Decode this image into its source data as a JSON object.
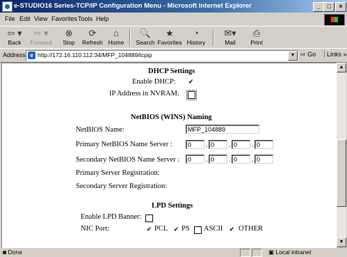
{
  "window": {
    "title": "e-STUDIO16 Series-TCP/IP Configuration Menu - Microsoft Internet Explorer",
    "buttons": {
      "minimize": "_",
      "maximize": "□",
      "close": "×"
    }
  },
  "menubar": {
    "items": [
      "File",
      "Edit",
      "View",
      "Favorites",
      "Tools",
      "Help"
    ]
  },
  "toolbar": {
    "back": "Back",
    "forward": "Forward",
    "stop": "Stop",
    "refresh": "Refresh",
    "home": "Home",
    "search": "Search",
    "favorites": "Favorites",
    "history": "History",
    "mail": "Mail",
    "print": "Print"
  },
  "address": {
    "label": "Address",
    "url": "http://172.16.110.112:34/MFP_104889/tcpip",
    "go": "Go",
    "links": "Links »"
  },
  "content": {
    "dhcp": {
      "heading": "DHCP Settings",
      "enable_label": "Enable DHCP:",
      "enable_checked": true,
      "nvram_label": "IP Address in NVRAM:",
      "nvram_checked": false
    },
    "netbios": {
      "heading": "NetBIOS (WINS) Naming",
      "name_label": "NetBIOS Name:",
      "name_value": "MFP_104889",
      "primary_label": "Primary NetBIOS Name Server :",
      "primary_octets": [
        "0",
        "0",
        "0",
        "0"
      ],
      "secondary_label": "Secondary NetBIOS Name Server :",
      "secondary_octets": [
        "0",
        "0",
        "0",
        "0"
      ],
      "primary_reg": "Primary Server Registration:",
      "secondary_reg": "Secondary Server Registration:"
    },
    "lpd": {
      "heading": "LPD Settings",
      "banner_label": "Enable LPD Banner:",
      "banner_checked": false,
      "nic_label": "NIC Port:",
      "ports": [
        {
          "label": "PCL",
          "checked": true
        },
        {
          "label": "PS",
          "checked": true
        },
        {
          "label": "ASCII",
          "checked": false
        },
        {
          "label": "OTHER",
          "checked": true
        }
      ]
    }
  },
  "statusbar": {
    "status": "Done",
    "zone": "Local intranet"
  },
  "check_mark": "✔"
}
